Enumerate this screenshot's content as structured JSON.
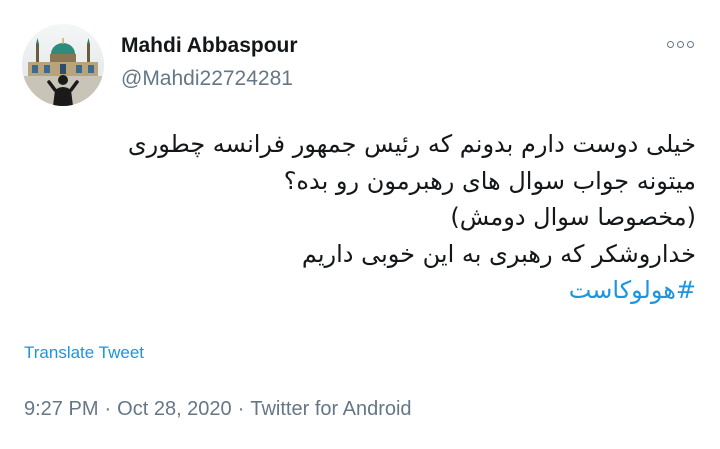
{
  "user": {
    "display_name": "Mahdi Abbaspour",
    "handle": "@Mahdi22724281",
    "avatar_icon": "mosque-photo-avatar"
  },
  "menu": {
    "icon": "more-horizontal-icon"
  },
  "tweet": {
    "lines": [
      "خیلی دوست دارم بدونم که رئیس جمهور فرانسه چطوری",
      "میتونه جواب سوال های رهبرمون رو بده؟",
      "(مخصوصا سوال دومش)",
      "خداروشکر که رهبری به این خوبی داریم"
    ],
    "hashtag": "#هولوکاست"
  },
  "translate_label": "Translate Tweet",
  "meta": {
    "time": "9:27 PM",
    "separator": "·",
    "date": "Oct 28, 2020",
    "source": "Twitter for Android"
  },
  "colors": {
    "link": "#1b95e0",
    "secondary_text": "#657786",
    "primary_text": "#14171a"
  }
}
